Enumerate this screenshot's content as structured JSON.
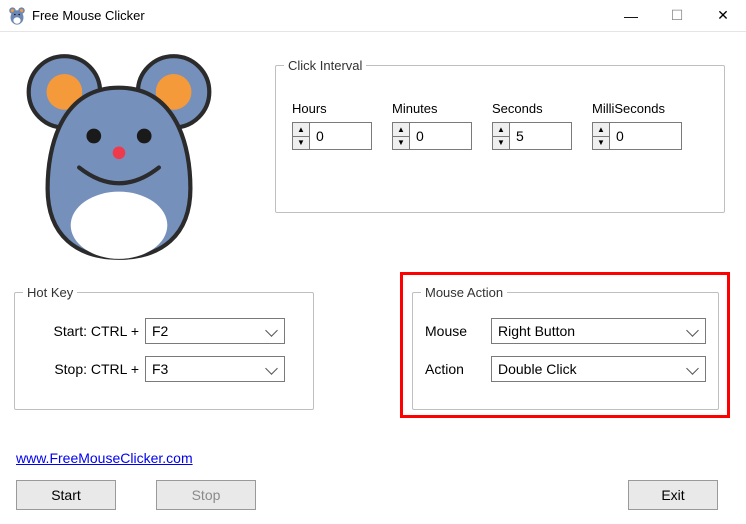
{
  "window": {
    "title": "Free Mouse Clicker"
  },
  "click_interval": {
    "legend": "Click Interval",
    "hours_label": "Hours",
    "minutes_label": "Minutes",
    "seconds_label": "Seconds",
    "ms_label": "MilliSeconds",
    "hours": "0",
    "minutes": "0",
    "seconds": "5",
    "ms": "0"
  },
  "hotkey": {
    "legend": "Hot Key",
    "start_label": "Start: CTRL +",
    "stop_label": "Stop: CTRL +",
    "start_value": "F2",
    "stop_value": "F3"
  },
  "mouse_action": {
    "legend": "Mouse Action",
    "mouse_label": "Mouse",
    "action_label": "Action",
    "mouse_value": "Right Button",
    "action_value": "Double Click"
  },
  "link": {
    "text": "www.FreeMouseClicker.com"
  },
  "buttons": {
    "start": "Start",
    "stop": "Stop",
    "exit": "Exit"
  }
}
